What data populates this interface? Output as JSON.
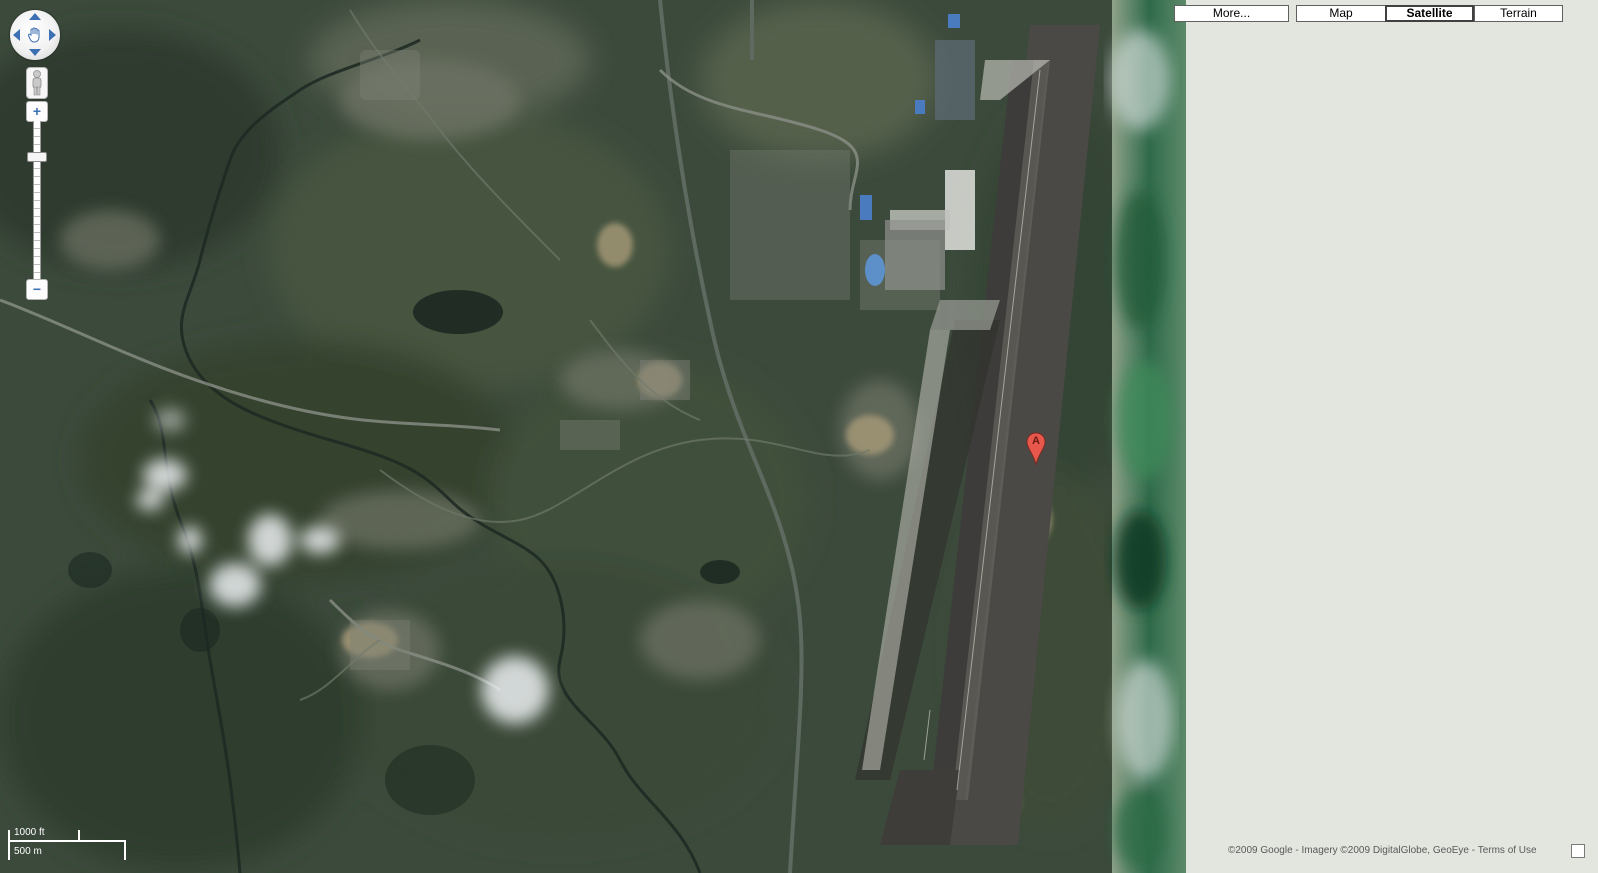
{
  "map_types": {
    "more_label": "More...",
    "map_label": "Map",
    "satellite_label": "Satellite",
    "terrain_label": "Terrain",
    "selected": "Satellite"
  },
  "controls": {
    "pan": "pan-control",
    "pegman": "street-view-pegman",
    "zoom_in_label": "+",
    "zoom_out_label": "−"
  },
  "scale": {
    "imperial_label": "1000 ft",
    "metric_label": "500 m"
  },
  "marker": {
    "label": "A",
    "color": "#e8574b"
  },
  "copyright": "©2009 Google - Imagery ©2009 DigitalGlobe, GeoEye - Terms of Use"
}
